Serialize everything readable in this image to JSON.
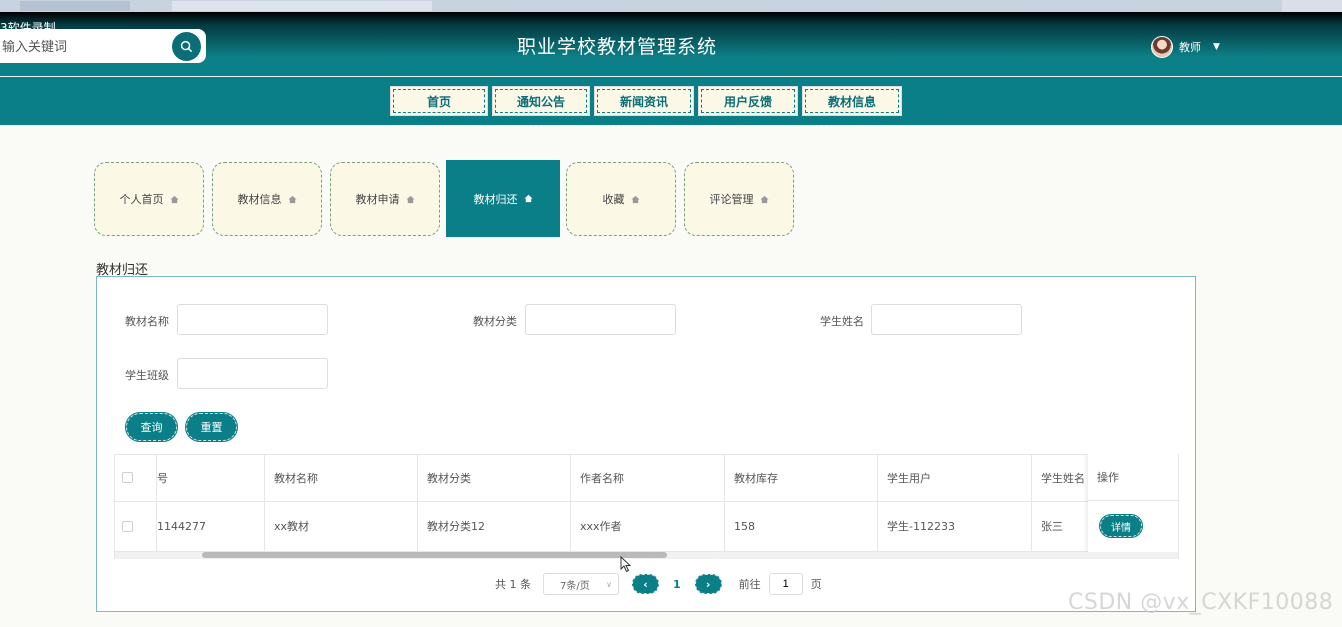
{
  "recording_label": "3软件录制",
  "header": {
    "search_placeholder": "输入关键词",
    "site_title": "职业学校教材管理系统",
    "user_name": "教师"
  },
  "nav": [
    {
      "label": "首页"
    },
    {
      "label": "通知公告"
    },
    {
      "label": "新闻资讯"
    },
    {
      "label": "用户反馈"
    },
    {
      "label": "教材信息"
    }
  ],
  "profile_tabs": [
    {
      "label": "个人首页"
    },
    {
      "label": "教材信息"
    },
    {
      "label": "教材申请"
    },
    {
      "label": "教材归还",
      "active": true
    },
    {
      "label": "收藏"
    },
    {
      "label": "评论管理"
    }
  ],
  "section_title": "教材归还",
  "filters": {
    "name_label": "教材名称",
    "category_label": "教材分类",
    "student_name_label": "学生姓名",
    "student_class_label": "学生班级"
  },
  "buttons": {
    "query": "查询",
    "reset": "重置"
  },
  "table": {
    "headers": [
      "号",
      "教材名称",
      "教材分类",
      "作者名称",
      "教材库存",
      "学生用户",
      "学生姓名",
      "操作"
    ],
    "rows": [
      {
        "no": "1144277",
        "name": "xx教材",
        "category": "教材分类12",
        "author": "xxx作者",
        "stock": "158",
        "student_user": "学生-112233",
        "student_name": "张三",
        "action": "详情"
      }
    ]
  },
  "pagination": {
    "total": "共 1 条",
    "page_size": "7条/页",
    "current_page": "1",
    "goto_label": "前往",
    "goto_value": "1",
    "page_suffix": "页"
  },
  "watermark": "CSDN @vx_CXKF10088",
  "colors": {
    "primary": "#0b7f88",
    "tab_bg": "#fbf8e6"
  }
}
